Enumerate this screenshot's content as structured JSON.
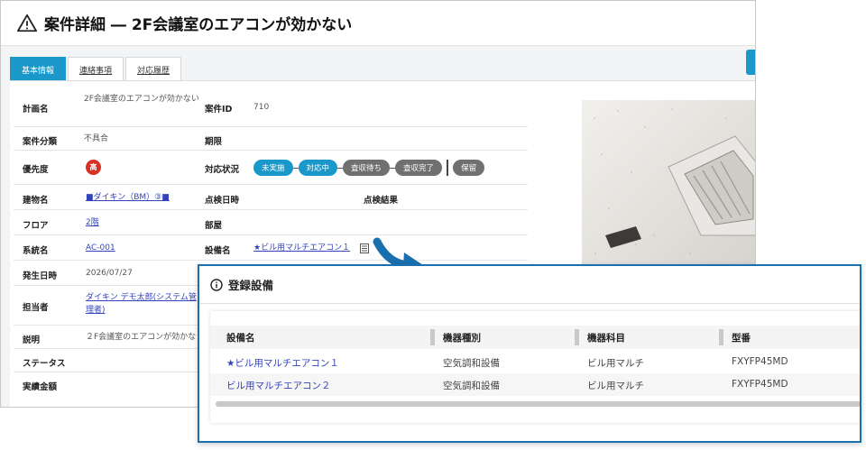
{
  "window": {
    "title": "案件詳細 ― 2F会議室のエアコンが効かない"
  },
  "tabs": [
    {
      "label": "基本情報"
    },
    {
      "label": "連絡事項"
    },
    {
      "label": "対応履歴"
    }
  ],
  "fields": {
    "plan_name": {
      "label": "計画名",
      "value": "2F会議室のエアコンが効かない"
    },
    "case_id": {
      "label": "案件ID",
      "value": "710"
    },
    "category": {
      "label": "案件分類",
      "value": "不具合"
    },
    "deadline": {
      "label": "期限",
      "value": ""
    },
    "priority": {
      "label": "優先度",
      "value": "高"
    },
    "status_label": "対応状況",
    "building": {
      "label": "建物名",
      "value": "■ダイキン（BM）③■"
    },
    "inspection_date": {
      "label": "点検日時",
      "value": ""
    },
    "inspection_result": {
      "label": "点検結果",
      "value": ""
    },
    "floor": {
      "label": "フロア",
      "value": "2階"
    },
    "room": {
      "label": "部屋",
      "value": ""
    },
    "system": {
      "label": "系統名",
      "value": "AC-001"
    },
    "equipment": {
      "label": "設備名",
      "value": "★ビル用マルチエアコン１"
    },
    "occurred": {
      "label": "発生日時",
      "value": "2026/07/27"
    },
    "assignee": {
      "label": "担当者",
      "value": "ダイキン デモ太郎(システム管理者)"
    },
    "description": {
      "label": "説明",
      "value": "２F会議室のエアコンが効かな"
    },
    "state": {
      "label": "ステータス",
      "value": ""
    },
    "amount": {
      "label": "実績金額",
      "value": ""
    }
  },
  "status_steps": [
    {
      "label": "未実施",
      "active": true
    },
    {
      "label": "対応中",
      "active": true
    },
    {
      "label": "査収待ち",
      "active": false
    },
    {
      "label": "査収完了",
      "active": false
    }
  ],
  "status_hold": "保留",
  "popup": {
    "title": "登録設備",
    "columns": [
      "設備名",
      "機器種別",
      "機器科目",
      "型番"
    ],
    "rows": [
      [
        "★ビル用マルチエアコン１",
        "空気調和設備",
        "ビル用マルチ",
        "FXYFP45MD"
      ],
      [
        "ビル用マルチエアコン２",
        "空気調和設備",
        "ビル用マルチ",
        "FXYFP45MD"
      ]
    ]
  },
  "colors": {
    "accent": "#1a98c9",
    "link": "#3344bb",
    "danger": "#d93025",
    "popup_border": "#1a6fae"
  }
}
